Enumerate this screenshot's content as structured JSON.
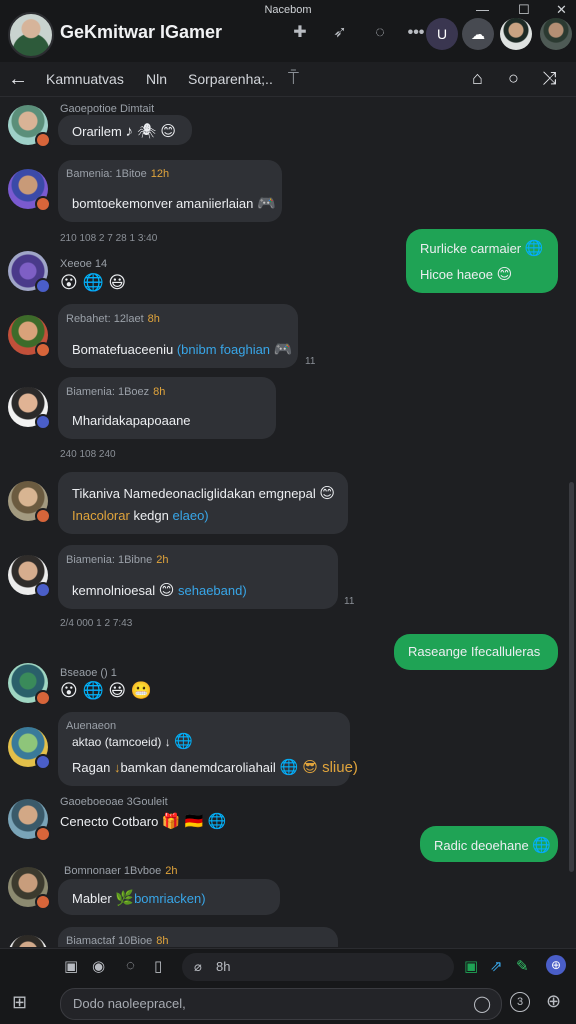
{
  "window": {
    "title": "Nacebom",
    "controls": [
      "—",
      "☐",
      "✕"
    ]
  },
  "topbar": {
    "app_name": "GeKmitwar IGamer",
    "icons": [
      "puzzle-icon",
      "rocket-icon",
      "chat-icon",
      "more-icon"
    ],
    "circle_button_label": "U"
  },
  "header": {
    "tabs": [
      "Kamnuatvas",
      "Nln",
      "Sorparenha;.."
    ],
    "icons": [
      "pin-icon",
      "home-icon",
      "search-icon",
      "shuffle-icon"
    ]
  },
  "feed": {
    "day_separators": [
      "210 108 2 7 28  1 3:40",
      "240 108         240",
      "2/4 000    1 2 7:43"
    ],
    "read_markers": [
      "11",
      "11"
    ],
    "messages": [
      {
        "name": "Gaoepotioe",
        "ts": "Dimtait",
        "text": "Orarilem",
        "emoji": "♪ 🕷 😊"
      },
      {
        "name": "Bamenia: 1Bitoe",
        "ts": "12h",
        "text": "bomtoekemonver amaniierlaian",
        "emoji": "🎮"
      },
      {
        "name": "Xeeoe",
        "ts": "14",
        "text": "",
        "emoji": "😮 🌐 😃"
      },
      {
        "name": "Rebahet: 12laet",
        "ts": "8h",
        "text": "Bomatefuaceeniu",
        "link": "(bnibm foaghian",
        "emoji": "🎮"
      },
      {
        "name": "Biamenia: 1Boez",
        "ts": "8h",
        "text": "Mharidakapapoaane",
        "emoji": ""
      },
      {
        "name": "",
        "ts": "",
        "text": "Tikaniva  Namedeonacliglidakan emgnepal",
        "line2a": "Inacolorar",
        "line2b": "kedgn",
        "line2c": "elaeo)",
        "emoji": "😊"
      },
      {
        "name": "Biamenia: 1Bibne",
        "ts": "2h",
        "text": "kemnolnioesal",
        "tail": "sehaeband)",
        "emoji": "😊"
      },
      {
        "name": "Bseaoe ()",
        "ts": "1",
        "text": "",
        "emoji": "😮 🌐 😃 😬"
      },
      {
        "name": "Auenaeon",
        "ts": "",
        "line1": "aktao (tamcoeid) ↓",
        "text": "Ragan",
        "tail": "bamkan danemdcaroliahail",
        "emoji2": "🌐 😎 sliue)",
        "emoji": "🌐"
      },
      {
        "name": "Gaoeboeoae 3Gouleit",
        "ts": "",
        "text": "Cenecto",
        "tail": "Cotbaro",
        "emoji": "🎁 🇩🇪 🌐"
      },
      {
        "name": "Bomnonaer 1Bvboe",
        "ts": "2h",
        "text": "Mabler",
        "link": "bomriacken)",
        "emoji": "🌿"
      },
      {
        "name": "Biamactaf 10Bioe",
        "ts": "8h",
        "text": "",
        "emoji": ""
      }
    ],
    "outgoing": [
      {
        "line1": "Rurlicke carmaier",
        "line2": "Hicoe haeoe",
        "emoji": "😊"
      },
      {
        "line1": "Raseange Ifecalluleras"
      },
      {
        "line1": "Radic deoehane",
        "emoji": "🌐"
      }
    ]
  },
  "composer": {
    "mini_placeholder": "8h",
    "placeholder": "Dodo naoleepracel,",
    "icons": [
      "image-icon",
      "record-icon",
      "sticker-icon",
      "clip-icon",
      "link-icon",
      "gif-icon",
      "share-icon",
      "pen-icon",
      "globe-icon",
      "grid-icon",
      "emoji-icon",
      "info-icon",
      "target-icon"
    ],
    "info_label": "3"
  },
  "colors": {
    "accent": "#1fa355",
    "bubble": "#2f3136",
    "background": "#1e1f22"
  }
}
